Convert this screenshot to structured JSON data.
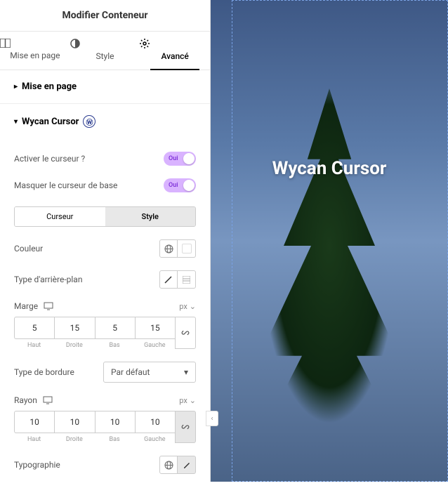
{
  "header": {
    "title": "Modifier Conteneur"
  },
  "tabs": [
    {
      "label": "Mise en page",
      "icon": "layout"
    },
    {
      "label": "Style",
      "icon": "contrast"
    },
    {
      "label": "Avancé",
      "icon": "gear",
      "active": true
    }
  ],
  "sections": {
    "layout": {
      "title": "Mise en page"
    },
    "cursor": {
      "title": "Wycan Cursor",
      "enable_label": "Activer le curseur ?",
      "enable_value": "Oui",
      "hide_label": "Masquer le curseur de base",
      "hide_value": "Oui",
      "subtabs": {
        "cursor": "Curseur",
        "style": "Style"
      },
      "color_label": "Couleur",
      "bg_label": "Type d'arrière-plan",
      "margin": {
        "label": "Marge",
        "unit": "px",
        "top": "5",
        "right": "15",
        "bottom": "5",
        "left": "15",
        "top_lbl": "Haut",
        "right_lbl": "Droite",
        "bottom_lbl": "Bas",
        "left_lbl": "Gauche"
      },
      "border_label": "Type de bordure",
      "border_value": "Par défaut",
      "radius": {
        "label": "Rayon",
        "unit": "px",
        "top": "10",
        "right": "10",
        "bottom": "10",
        "left": "10",
        "top_lbl": "Haut",
        "right_lbl": "Droite",
        "bottom_lbl": "Bas",
        "left_lbl": "Gauche"
      },
      "typo_label": "Typographie"
    }
  },
  "preview": {
    "title": "Wycan Cursor"
  }
}
